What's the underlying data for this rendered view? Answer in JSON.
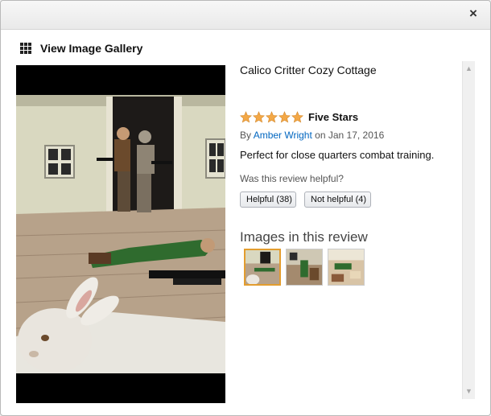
{
  "dialog": {
    "close_label": "×",
    "gallery_label": "View Image Gallery"
  },
  "review": {
    "product_title": "Calico Critter Cozy Cottage",
    "rating": 5,
    "rating_max": 5,
    "title": "Five Stars",
    "by_prefix": "By",
    "author": "Amber Wright",
    "date": "on Jan 17, 2016",
    "body": "Perfect for close quarters combat training.",
    "helpful_question": "Was this review helpful?",
    "helpful_button": "Helpful (38)",
    "not_helpful_button": "Not helpful (4)"
  },
  "images": {
    "heading": "Images in this review",
    "count": 3,
    "selected_index": 0
  },
  "colors": {
    "star": "#f3a847",
    "link": "#0066c0",
    "thumb_selected_border": "#e39d2f"
  }
}
